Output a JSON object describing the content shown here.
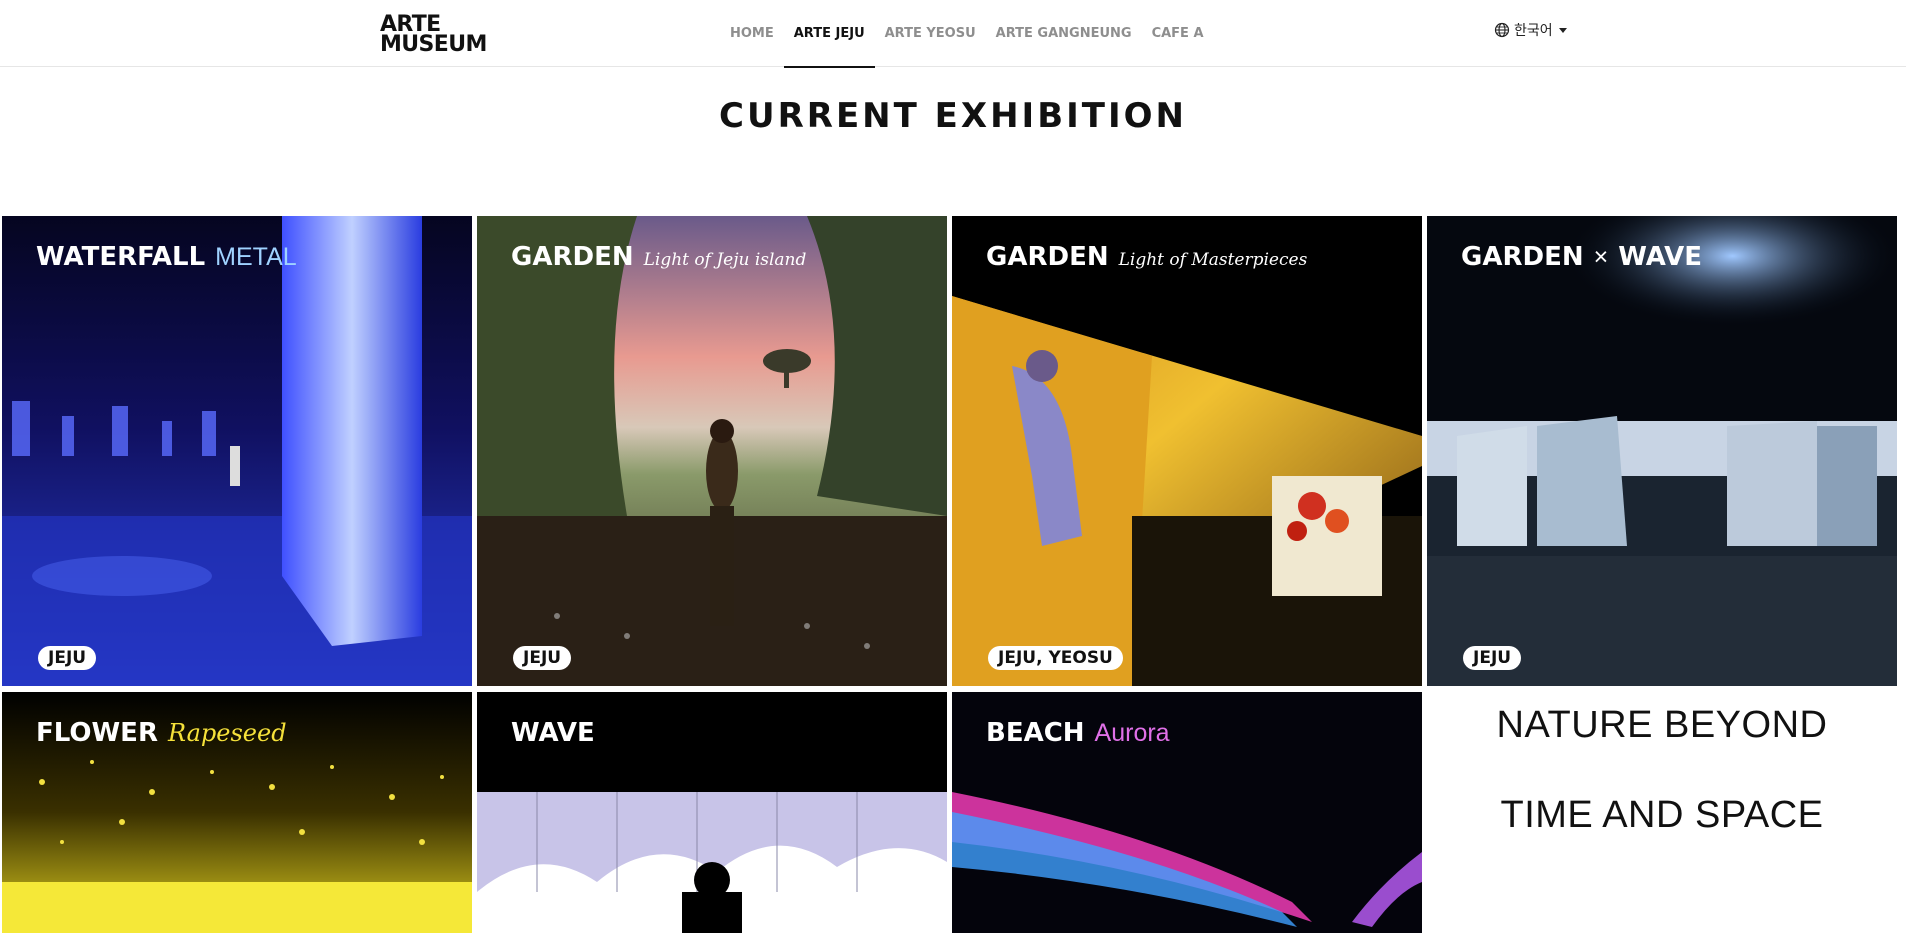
{
  "header": {
    "logo_line1": "ARTE",
    "logo_line2": "MUSEUM",
    "nav": [
      {
        "label": "HOME",
        "active": false
      },
      {
        "label": "ARTE JEJU",
        "active": true
      },
      {
        "label": "ARTE YEOSU",
        "active": false
      },
      {
        "label": "ARTE GANGNEUNG",
        "active": false
      },
      {
        "label": "CAFE A",
        "active": false
      }
    ],
    "language": "한국어",
    "language_icon": "globe-icon"
  },
  "section_title": "CURRENT EXHIBITION",
  "cards": [
    {
      "title": "WATERFALL",
      "subtitle": "METAL",
      "subtitle_color": "#9fd2ff",
      "location": "JEJU"
    },
    {
      "title": "GARDEN",
      "subtitle": "Light of Jeju island",
      "subtitle_color": "#ffffff",
      "location": "JEJU"
    },
    {
      "title": "GARDEN",
      "subtitle": "Light of Masterpieces",
      "subtitle_color": "#ffffff",
      "location": "JEJU, YEOSU"
    },
    {
      "title": "GARDEN",
      "subtitle": "×",
      "title2": "WAVE",
      "subtitle_color": "#ffffff",
      "location": "JEJU"
    },
    {
      "title": "FLOWER",
      "subtitle": "Rapeseed",
      "subtitle_color": "#f5e13a",
      "location": ""
    },
    {
      "title": "WAVE",
      "subtitle": "",
      "subtitle_color": "#ffffff",
      "location": ""
    },
    {
      "title": "BEACH",
      "subtitle": "Aurora",
      "subtitle_color": "#e070e8",
      "location": ""
    }
  ],
  "side_text": {
    "line1": "NATURE BEYOND",
    "line2": "TIME AND SPACE"
  }
}
